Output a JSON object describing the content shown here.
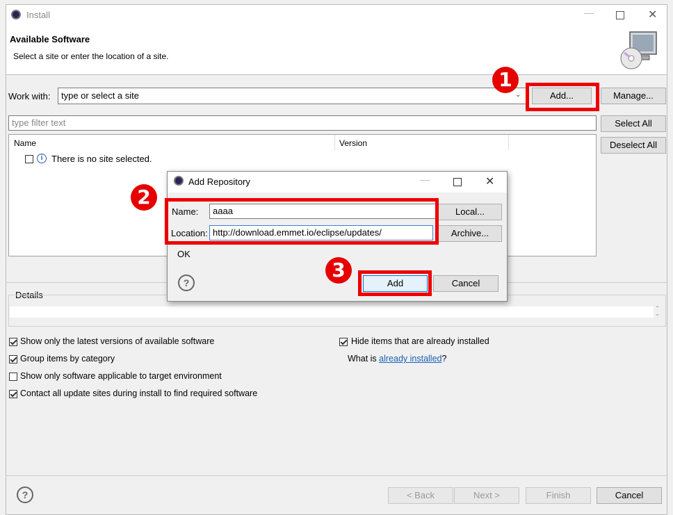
{
  "window": {
    "title": "Install"
  },
  "header": {
    "heading": "Available Software",
    "subtitle": "Select a site or enter the location of a site."
  },
  "work_with": {
    "label": "Work with:",
    "value": "type or select a site",
    "add_label": "Add...",
    "manage_label": "Manage..."
  },
  "filter": {
    "placeholder": "type filter text"
  },
  "table": {
    "columns": [
      "Name",
      "Version"
    ],
    "empty_message": "There is no site selected."
  },
  "side_buttons": {
    "select_all": "Select All",
    "deselect_all": "Deselect All"
  },
  "details": {
    "label": "Details"
  },
  "options": {
    "latest": {
      "label": "Show only the latest versions of available software",
      "checked": true
    },
    "group": {
      "label": "Group items by category",
      "checked": true
    },
    "target": {
      "label": "Show only software applicable to target environment",
      "checked": false
    },
    "contact": {
      "label": "Contact all update sites during install to find required software",
      "checked": true
    },
    "hide": {
      "label": "Hide items that are already installed",
      "checked": true
    },
    "what_is_prefix": "What is ",
    "what_is_link": "already installed",
    "what_is_suffix": "?"
  },
  "footer": {
    "back": "< Back",
    "next": "Next >",
    "finish": "Finish",
    "cancel": "Cancel"
  },
  "dialog": {
    "title": "Add Repository",
    "name_label": "Name:",
    "name_value": "aaaa",
    "location_label": "Location:",
    "location_value": "http://download.emmet.io/eclipse/updates/",
    "local_label": "Local...",
    "archive_label": "Archive...",
    "status": "OK",
    "add_label": "Add",
    "cancel_label": "Cancel"
  },
  "annotations": {
    "step1": "1",
    "step2": "2",
    "step3": "3",
    "color": "#e60000"
  }
}
